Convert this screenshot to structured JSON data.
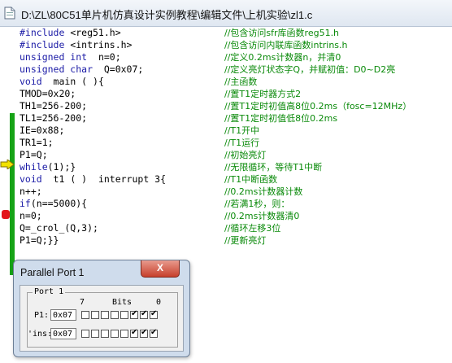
{
  "window": {
    "title": "D:\\ZL\\80C51单片机仿真设计实例教程\\编辑文件\\上机实验\\zl1.c"
  },
  "editor": {
    "lines": [
      {
        "code_kw": "#include",
        "code_rest": " <reg51.h>",
        "comment": "//包含访问sfr库函数reg51.h"
      },
      {
        "code_kw": "#include",
        "code_rest": " <intrins.h>",
        "comment": "//包含访问内联库函数intrins.h"
      },
      {
        "code_kw": "unsigned int",
        "code_rest": "  n=0;",
        "comment": "//定义0.2ms计数器n，并清0"
      },
      {
        "code_kw": "unsigned char",
        "code_rest": "  Q=0x07;",
        "comment": "//定义亮灯状态字Q，并赋初值：D0~D2亮"
      },
      {
        "code_kw": "void",
        "code_rest": "  main ( ){",
        "comment": "//主函数"
      },
      {
        "code_kw": "",
        "code_rest": "TMOD=0x20;",
        "comment": "//置T1定时器方式2"
      },
      {
        "code_kw": "",
        "code_rest": "TH1=256-200;",
        "comment": "//置T1定时初值高8位0.2ms（fosc=12MHz）"
      },
      {
        "code_kw": "",
        "code_rest": "TL1=256-200;",
        "comment": "//置T1定时初值低8位0.2ms"
      },
      {
        "code_kw": "",
        "code_rest": "IE=0x88;",
        "comment": "//T1开中"
      },
      {
        "code_kw": "",
        "code_rest": "TR1=1;",
        "comment": "//T1运行"
      },
      {
        "code_kw": "",
        "code_rest": "P1=Q;",
        "comment": "//初始亮灯"
      },
      {
        "code_kw": "while",
        "code_rest": "(1);}",
        "comment": "//无限循环，等待T1中断"
      },
      {
        "code_kw": "void",
        "code_rest": "  t1 ( )  interrupt 3{",
        "comment": "//T1中断函数"
      },
      {
        "code_kw": "",
        "code_rest": "n++;",
        "comment": "//0.2ms计数器计数"
      },
      {
        "code_kw": "if",
        "code_rest": "(n==5000){",
        "comment": "//若满1秒，则："
      },
      {
        "code_kw": "",
        "code_rest": "n=0;",
        "comment": "//0.2ms计数器清0"
      },
      {
        "code_kw": "",
        "code_rest": "Q=_crol_(Q,3);",
        "comment": "//循环左移3位"
      },
      {
        "code_kw": "",
        "code_rest": "P1=Q;}}",
        "comment": "//更新亮灯"
      }
    ]
  },
  "dialog": {
    "title": "Parallel Port 1",
    "close_label": "X",
    "group_label": "Port 1",
    "bits_high_label": "7",
    "bits_label": "Bits",
    "bits_low_label": "0",
    "p1_label": "P1:",
    "p1_value": "0x07",
    "pins_label": "'ins:",
    "pins_value": "0x07",
    "p1_bits": [
      false,
      false,
      false,
      false,
      false,
      true,
      true,
      true
    ],
    "pins_bits": [
      false,
      false,
      false,
      false,
      false,
      true,
      true,
      true
    ]
  },
  "colors": {
    "keyword": "#1a1aa6",
    "comment": "#0a8a0a",
    "coverage": "#16a316",
    "breakpoint": "#e3141b"
  }
}
